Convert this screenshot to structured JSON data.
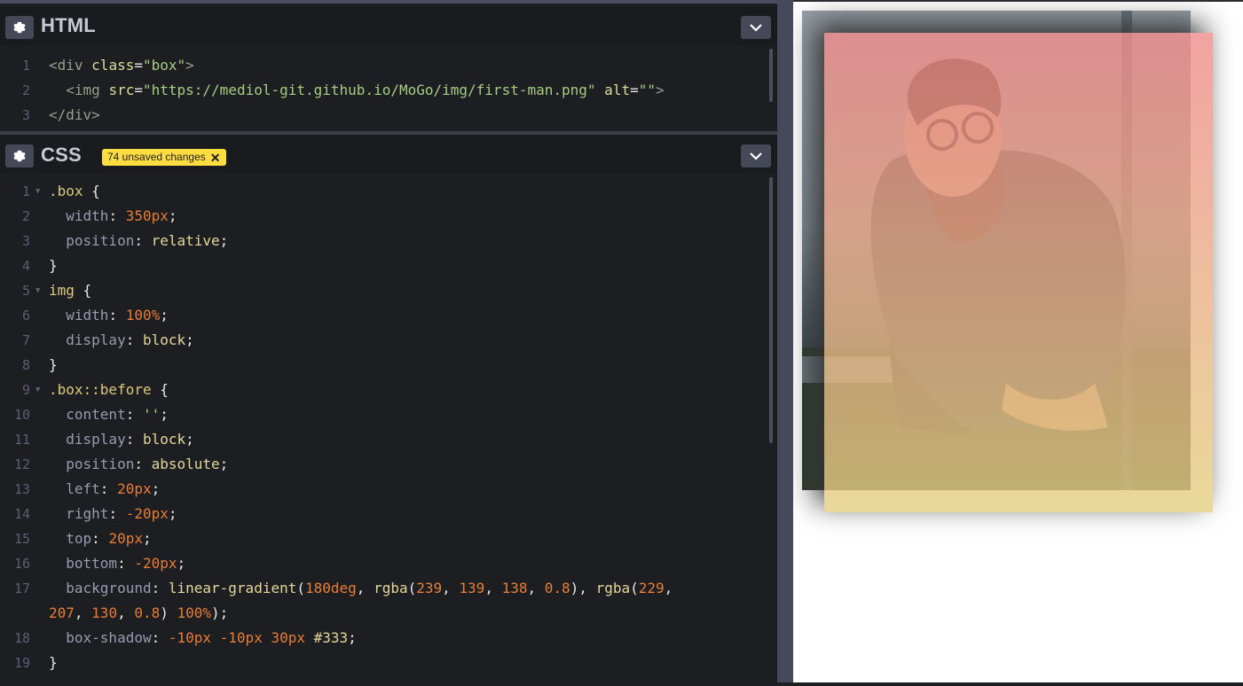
{
  "html_pane": {
    "title": "HTML",
    "lines": [
      {
        "n": "1",
        "html": [
          [
            "t-tag",
            "<"
          ],
          [
            "t-tag",
            "div "
          ],
          [
            "t-attr",
            "class"
          ],
          [
            "t-punc",
            "="
          ],
          [
            "t-str",
            "\"box\""
          ],
          [
            "t-tag",
            ">"
          ]
        ]
      },
      {
        "n": "2",
        "html": [
          [
            "t-tag",
            "  <img "
          ],
          [
            "t-attr",
            "src"
          ],
          [
            "t-punc",
            "="
          ],
          [
            "t-str",
            "\"https://mediol-git.github.io/MoGo/img/first-man.png\""
          ],
          [
            "t-punc",
            " "
          ],
          [
            "t-attr",
            "alt"
          ],
          [
            "t-punc",
            "="
          ],
          [
            "t-str",
            "\"\""
          ],
          [
            "t-tag",
            ">"
          ]
        ]
      },
      {
        "n": "3",
        "html": [
          [
            "t-tag",
            "</div>"
          ]
        ]
      }
    ]
  },
  "css_pane": {
    "title": "CSS",
    "badge": "74 unsaved changes",
    "badge_close": "✕",
    "lines": [
      {
        "n": "1",
        "fold": true,
        "html": [
          [
            "t-sel",
            ".box"
          ],
          [
            "t-punc",
            " {"
          ]
        ]
      },
      {
        "n": "2",
        "html": [
          [
            "t-prop",
            "  width"
          ],
          [
            "t-punc",
            ": "
          ],
          [
            "t-num",
            "350px"
          ],
          [
            "t-punc",
            ";"
          ]
        ]
      },
      {
        "n": "3",
        "html": [
          [
            "t-prop",
            "  position"
          ],
          [
            "t-punc",
            ": "
          ],
          [
            "t-val",
            "relative"
          ],
          [
            "t-punc",
            ";"
          ]
        ]
      },
      {
        "n": "4",
        "html": [
          [
            "t-punc",
            "}"
          ]
        ]
      },
      {
        "n": "5",
        "fold": true,
        "html": [
          [
            "t-sel",
            "img"
          ],
          [
            "t-punc",
            " {"
          ]
        ]
      },
      {
        "n": "6",
        "html": [
          [
            "t-prop",
            "  width"
          ],
          [
            "t-punc",
            ": "
          ],
          [
            "t-num",
            "100%"
          ],
          [
            "t-punc",
            ";"
          ]
        ]
      },
      {
        "n": "7",
        "html": [
          [
            "t-prop",
            "  display"
          ],
          [
            "t-punc",
            ": "
          ],
          [
            "t-val",
            "block"
          ],
          [
            "t-punc",
            ";"
          ]
        ]
      },
      {
        "n": "8",
        "html": [
          [
            "t-punc",
            "}"
          ]
        ]
      },
      {
        "n": "9",
        "fold": true,
        "html": [
          [
            "t-sel",
            ".box::before"
          ],
          [
            "t-punc",
            " {"
          ]
        ]
      },
      {
        "n": "10",
        "html": [
          [
            "t-prop",
            "  content"
          ],
          [
            "t-punc",
            ": "
          ],
          [
            "t-str",
            "''"
          ],
          [
            "t-punc",
            ";"
          ]
        ]
      },
      {
        "n": "11",
        "html": [
          [
            "t-prop",
            "  display"
          ],
          [
            "t-punc",
            ": "
          ],
          [
            "t-val",
            "block"
          ],
          [
            "t-punc",
            ";"
          ]
        ]
      },
      {
        "n": "12",
        "html": [
          [
            "t-prop",
            "  position"
          ],
          [
            "t-punc",
            ": "
          ],
          [
            "t-val",
            "absolute"
          ],
          [
            "t-punc",
            ";"
          ]
        ]
      },
      {
        "n": "13",
        "html": [
          [
            "t-prop",
            "  left"
          ],
          [
            "t-punc",
            ": "
          ],
          [
            "t-num",
            "20px"
          ],
          [
            "t-punc",
            ";"
          ]
        ]
      },
      {
        "n": "14",
        "html": [
          [
            "t-prop",
            "  right"
          ],
          [
            "t-punc",
            ": "
          ],
          [
            "t-num",
            "-20px"
          ],
          [
            "t-punc",
            ";"
          ]
        ]
      },
      {
        "n": "15",
        "html": [
          [
            "t-prop",
            "  top"
          ],
          [
            "t-punc",
            ": "
          ],
          [
            "t-num",
            "20px"
          ],
          [
            "t-punc",
            ";"
          ]
        ]
      },
      {
        "n": "16",
        "html": [
          [
            "t-prop",
            "  bottom"
          ],
          [
            "t-punc",
            ": "
          ],
          [
            "t-num",
            "-20px"
          ],
          [
            "t-punc",
            ";"
          ]
        ]
      },
      {
        "n": "17",
        "html": [
          [
            "t-prop",
            "  background"
          ],
          [
            "t-punc",
            ": "
          ],
          [
            "t-val",
            "linear-gradient"
          ],
          [
            "t-punc",
            "("
          ],
          [
            "t-num",
            "180deg"
          ],
          [
            "t-punc",
            ", "
          ],
          [
            "t-val",
            "rgba"
          ],
          [
            "t-punc",
            "("
          ],
          [
            "t-num",
            "239"
          ],
          [
            "t-punc",
            ", "
          ],
          [
            "t-num",
            "139"
          ],
          [
            "t-punc",
            ", "
          ],
          [
            "t-num",
            "138"
          ],
          [
            "t-punc",
            ", "
          ],
          [
            "t-num",
            "0.8"
          ],
          [
            "t-punc",
            "), "
          ],
          [
            "t-val",
            "rgba"
          ],
          [
            "t-punc",
            "("
          ],
          [
            "t-num",
            "229"
          ],
          [
            "t-punc",
            ","
          ]
        ]
      },
      {
        "n": "",
        "html": [
          [
            "t-num",
            "207"
          ],
          [
            "t-punc",
            ", "
          ],
          [
            "t-num",
            "130"
          ],
          [
            "t-punc",
            ", "
          ],
          [
            "t-num",
            "0.8"
          ],
          [
            "t-punc",
            ") "
          ],
          [
            "t-num",
            "100%"
          ],
          [
            "t-punc",
            ");"
          ]
        ]
      },
      {
        "n": "18",
        "html": [
          [
            "t-prop",
            "  box-shadow"
          ],
          [
            "t-punc",
            ": "
          ],
          [
            "t-num",
            "-10px -10px 30px"
          ],
          [
            "t-punc",
            " "
          ],
          [
            "t-val",
            "#333"
          ],
          [
            "t-punc",
            ";"
          ]
        ]
      },
      {
        "n": "19",
        "html": [
          [
            "t-punc",
            "}"
          ]
        ]
      }
    ]
  },
  "colors": {
    "editor_bg": "#1d1e22",
    "header_bg": "#1a1b1f",
    "badge_bg": "#ffdd40",
    "button_bg": "#444857"
  }
}
